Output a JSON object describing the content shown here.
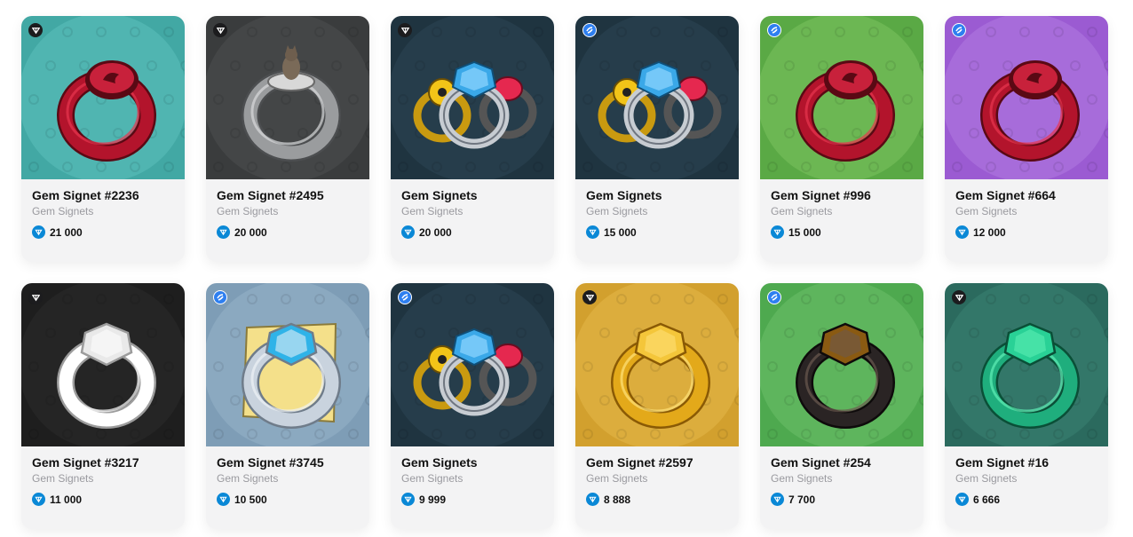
{
  "cards": [
    {
      "title": "Gem Signet #2236",
      "collection": "Gem Signets",
      "price": "21 000",
      "marker": "dark",
      "bg": "#42a8a4",
      "bg2": "#5cc0bb",
      "ring": "red",
      "gem": "red-signet"
    },
    {
      "title": "Gem Signet #2495",
      "collection": "Gem Signets",
      "price": "20 000",
      "marker": "dark",
      "bg": "#3a3c3d",
      "bg2": "#4c4f50",
      "ring": "silver",
      "gem": "cat"
    },
    {
      "title": "Gem Signets",
      "collection": "Gem Signets",
      "price": "20 000",
      "marker": "dark",
      "bg": "#1f3440",
      "bg2": "#2b4554",
      "ring": "trio",
      "gem": "trio"
    },
    {
      "title": "Gem Signets",
      "collection": "Gem Signets",
      "price": "15 000",
      "marker": "blue",
      "bg": "#1f3440",
      "bg2": "#2b4554",
      "ring": "trio",
      "gem": "trio"
    },
    {
      "title": "Gem Signet #996",
      "collection": "Gem Signets",
      "price": "15 000",
      "marker": "blue",
      "bg": "#5aa945",
      "bg2": "#7cc25e",
      "ring": "red",
      "gem": "red-signet"
    },
    {
      "title": "Gem Signet #664",
      "collection": "Gem Signets",
      "price": "12 000",
      "marker": "blue",
      "bg": "#9b5bd2",
      "bg2": "#b07ae0",
      "ring": "red",
      "gem": "red-signet"
    },
    {
      "title": "Gem Signet #3217",
      "collection": "Gem Signets",
      "price": "11 000",
      "marker": "dark",
      "bg": "#1e1e1e",
      "bg2": "#2c2c2c",
      "ring": "white",
      "gem": "white-diamond"
    },
    {
      "title": "Gem Signet #3745",
      "collection": "Gem Signets",
      "price": "10 500",
      "marker": "blue",
      "bg": "#7e9db6",
      "bg2": "#96b3c9",
      "ring": "paper",
      "gem": "blue-diamond"
    },
    {
      "title": "Gem Signets",
      "collection": "Gem Signets",
      "price": "9 999",
      "marker": "blue",
      "bg": "#1f3440",
      "bg2": "#2b4554",
      "ring": "trio",
      "gem": "trio"
    },
    {
      "title": "Gem Signet #2597",
      "collection": "Gem Signets",
      "price": "8 888",
      "marker": "dark",
      "bg": "#d2a02e",
      "bg2": "#e3b84a",
      "ring": "gold",
      "gem": "gold"
    },
    {
      "title": "Gem Signet #254",
      "collection": "Gem Signets",
      "price": "7 700",
      "marker": "blue",
      "bg": "#4ea94f",
      "bg2": "#6bc06a",
      "ring": "black",
      "gem": "amber"
    },
    {
      "title": "Gem Signet #16",
      "collection": "Gem Signets",
      "price": "6 666",
      "marker": "dark",
      "bg": "#2b6a5e",
      "bg2": "#3a8173",
      "ring": "emerald",
      "gem": "emerald"
    }
  ]
}
